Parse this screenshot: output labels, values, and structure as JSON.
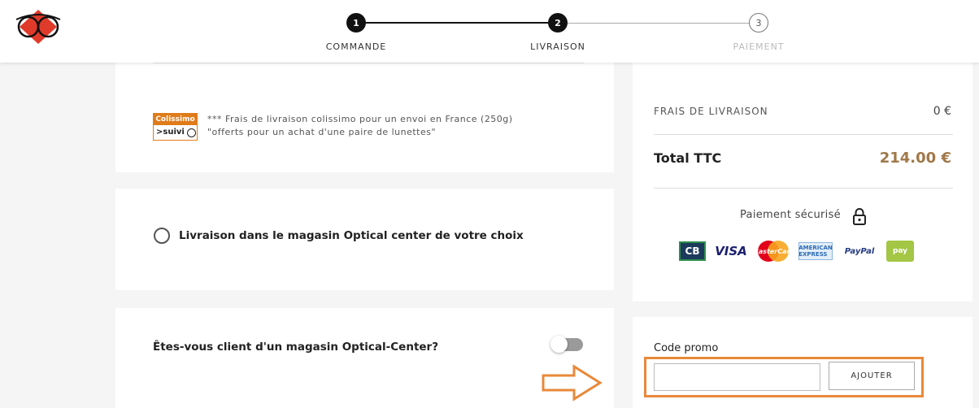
{
  "steps": [
    {
      "number": "1",
      "label": "COMMANDE"
    },
    {
      "number": "2",
      "label": "LIVRAISON"
    },
    {
      "number": "3",
      "label": "PAIEMENT"
    }
  ],
  "shipping": {
    "colissimo_top": "Colissimo",
    "colissimo_bottom": ">suivi",
    "note_line1": "*** Frais de livraison colissimo pour un envoi en France (250g)",
    "note_line2": "\"offerts pour un achat d'une paire de lunettes\""
  },
  "store_option": {
    "label": "Livraison dans le magasin Optical center de votre choix"
  },
  "client": {
    "question": "Êtes-vous client d'un magasin Optical-Center?"
  },
  "summary": {
    "shipping_label": "FRAIS DE LIVRAISON",
    "shipping_value": "0 €",
    "total_label": "Total TTC",
    "total_value": "214.00 €",
    "secure_label": "Paiement sécurisé",
    "payment_methods": [
      "CB",
      "VISA",
      "MasterCard",
      "AMERICAN EXPRESS",
      "PayPal",
      "pay"
    ]
  },
  "promo": {
    "label": "Code promo",
    "input_value": "",
    "button_label": "AJOUTER"
  },
  "colors": {
    "accent": "#e8893a",
    "total": "#a07848",
    "logo_red": "#e03a2a"
  }
}
